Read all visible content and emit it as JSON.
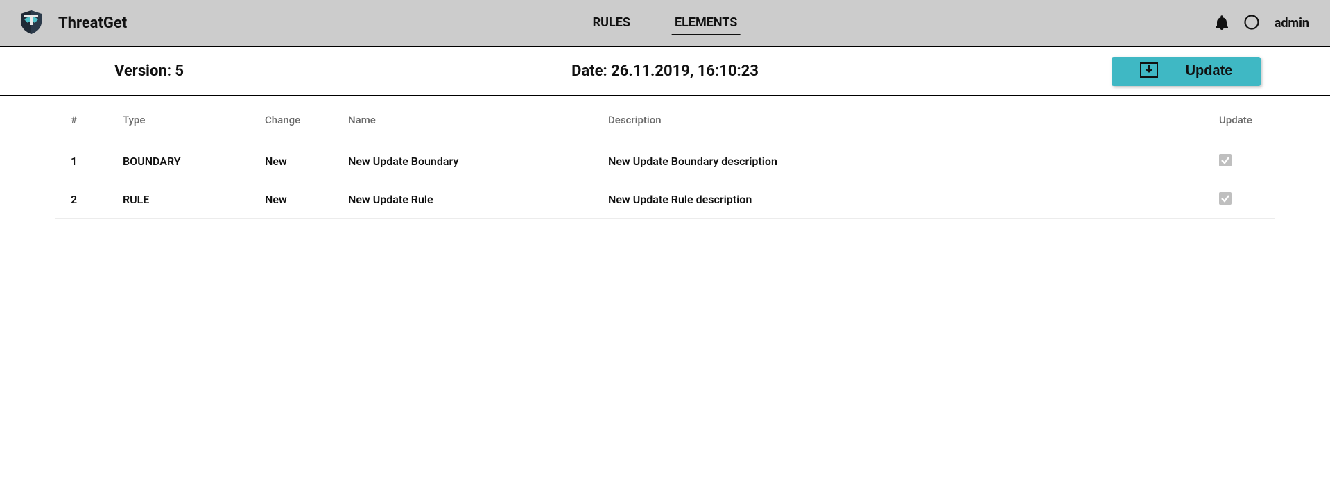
{
  "header": {
    "app_name": "ThreatGet",
    "tabs": [
      {
        "label": "RULES",
        "active": false
      },
      {
        "label": "ELEMENTS",
        "active": true
      }
    ],
    "user_name": "admin"
  },
  "infobar": {
    "version_label": "Version:",
    "version_value": "5",
    "date_label": "Date:",
    "date_value": "26.11.2019, 16:10:23",
    "update_button_label": "Update"
  },
  "table": {
    "columns": {
      "num": "#",
      "type": "Type",
      "change": "Change",
      "name": "Name",
      "description": "Description",
      "update": "Update"
    },
    "rows": [
      {
        "num": "1",
        "type": "BOUNDARY",
        "change": "New",
        "name": "New Update Boundary",
        "description": "New Update Boundary description",
        "update_checked": true
      },
      {
        "num": "2",
        "type": "RULE",
        "change": "New",
        "name": "New Update Rule",
        "description": "New Update Rule description",
        "update_checked": true
      }
    ]
  }
}
